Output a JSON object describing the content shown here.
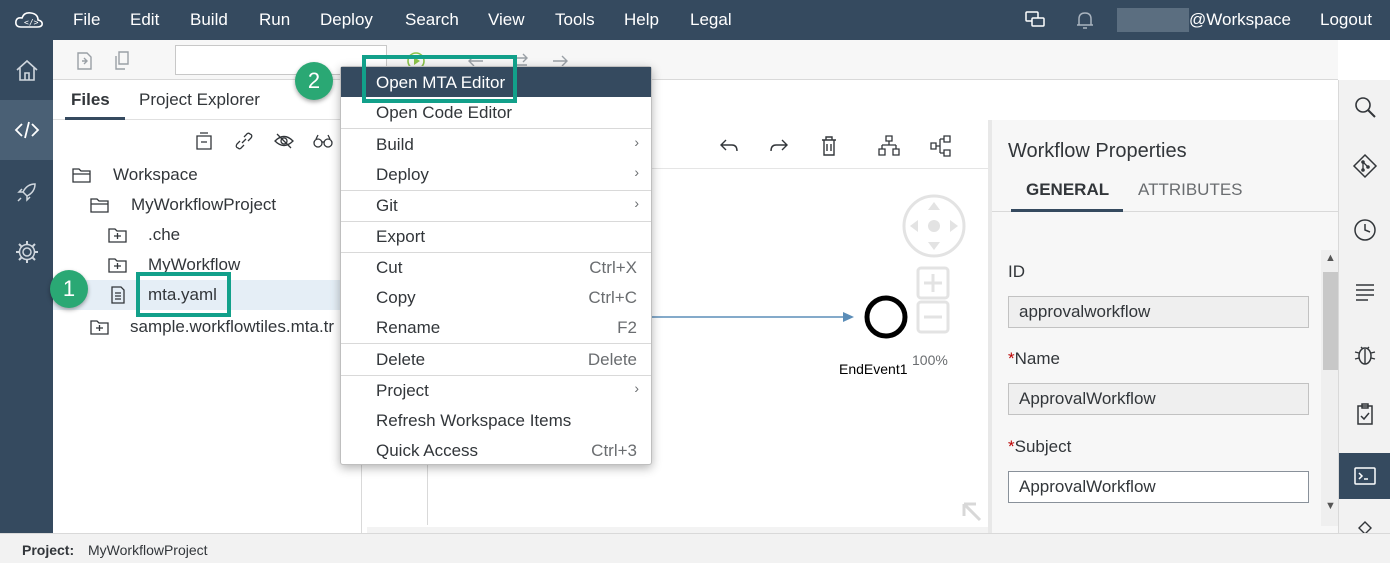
{
  "menubar": {
    "items": [
      "File",
      "Edit",
      "Build",
      "Run",
      "Deploy",
      "Search",
      "View",
      "Tools",
      "Help",
      "Legal"
    ],
    "user": "@Workspace",
    "logout": "Logout"
  },
  "files_panel": {
    "tabs": [
      "Files",
      "Project Explorer"
    ],
    "tree": [
      {
        "label": "Workspace",
        "icon": "folder-open-icon"
      },
      {
        "label": "MyWorkflowProject",
        "icon": "folder-open-icon"
      },
      {
        "label": ".che",
        "icon": "folder-closed-icon"
      },
      {
        "label": "MyWorkflow",
        "icon": "folder-closed-icon"
      },
      {
        "label": "mta.yaml",
        "icon": "document-icon"
      },
      {
        "label": "sample.workflowtiles.mta.tr",
        "icon": "folder-closed-icon"
      }
    ]
  },
  "callouts": {
    "one": "1",
    "two": "2"
  },
  "context_menu": {
    "items": [
      {
        "label": "Open MTA Editor",
        "shortcut": "",
        "submenu": false
      },
      {
        "label": "Open Code Editor",
        "shortcut": "",
        "submenu": false
      },
      {
        "label": "Build",
        "shortcut": "",
        "submenu": true
      },
      {
        "label": "Deploy",
        "shortcut": "",
        "submenu": true
      },
      {
        "label": "Git",
        "shortcut": "",
        "submenu": true
      },
      {
        "label": "Export",
        "shortcut": "",
        "submenu": false
      },
      {
        "label": "Cut",
        "shortcut": "Ctrl+X",
        "submenu": false
      },
      {
        "label": "Copy",
        "shortcut": "Ctrl+C",
        "submenu": false
      },
      {
        "label": "Rename",
        "shortcut": "F2",
        "submenu": false
      },
      {
        "label": "Delete",
        "shortcut": "Delete",
        "submenu": false
      },
      {
        "label": "Project",
        "shortcut": "",
        "submenu": true
      },
      {
        "label": "Refresh Workspace Items",
        "shortcut": "",
        "submenu": false
      },
      {
        "label": "Quick Access",
        "shortcut": "Ctrl+3",
        "submenu": false
      }
    ]
  },
  "editor": {
    "end_event_label": "EndEvent1",
    "zoom": "100%"
  },
  "properties": {
    "title": "Workflow Properties",
    "tabs": [
      "GENERAL",
      "ATTRIBUTES"
    ],
    "fields": {
      "id_label": "ID",
      "id_value": "approvalworkflow",
      "name_label": "Name",
      "name_value": "ApprovalWorkflow",
      "subject_label": "Subject",
      "subject_value": "ApprovalWorkflow",
      "required_mark": "*"
    }
  },
  "statusbar": {
    "label": "Project:",
    "value": "MyWorkflowProject"
  },
  "colors": {
    "shell": "#354a5f",
    "highlight": "#12a08a",
    "callout": "#2aa874"
  }
}
